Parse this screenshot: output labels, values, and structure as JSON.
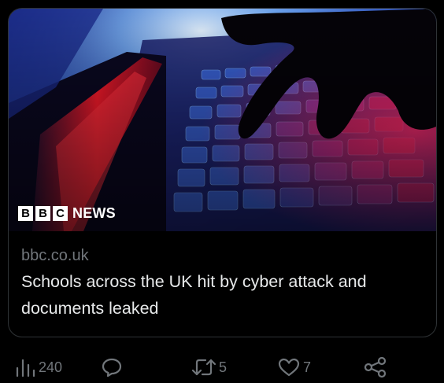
{
  "card": {
    "image_logo": {
      "blocks": [
        "B",
        "B",
        "C"
      ],
      "word": "NEWS"
    },
    "domain": "bbc.co.uk",
    "headline": "Schools across the UK hit by cyber attack and documents leaked"
  },
  "actions": {
    "views": {
      "count": "240",
      "icon": "bar-chart-icon"
    },
    "reply": {
      "count": "",
      "icon": "speech-bubble-icon"
    },
    "repost": {
      "count": "5",
      "icon": "repost-arrows-icon"
    },
    "like": {
      "count": "7",
      "icon": "heart-icon"
    },
    "share": {
      "count": "",
      "icon": "share-nodes-icon"
    }
  },
  "colors": {
    "background": "#000000",
    "border": "#2f3336",
    "primary_text": "#e7e9ea",
    "secondary_text": "#71767b"
  }
}
